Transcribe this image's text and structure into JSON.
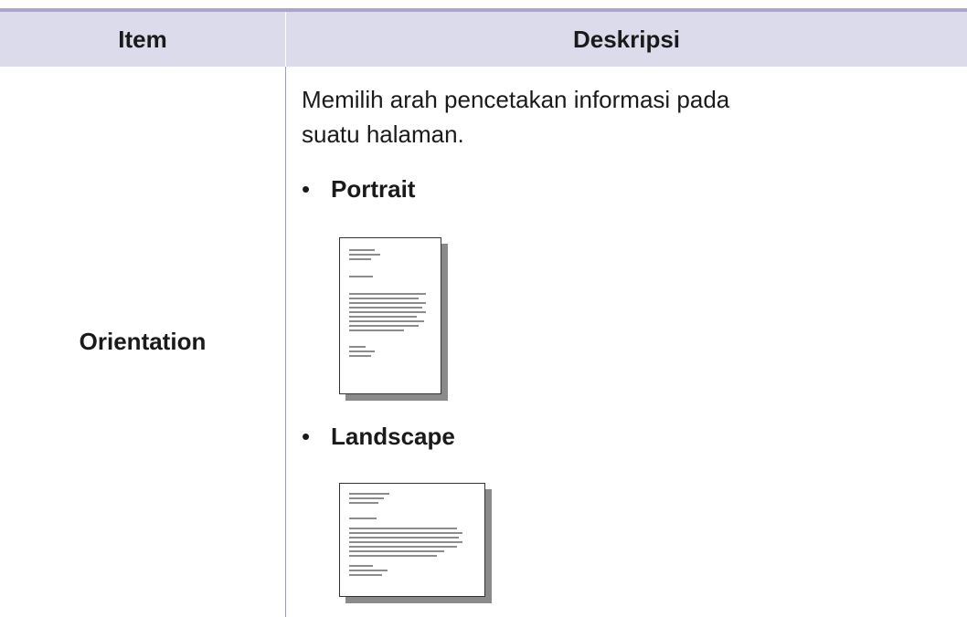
{
  "table": {
    "header": {
      "item": "Item",
      "description": "Deskripsi"
    },
    "row": {
      "item": "Orientation",
      "description": "Memilih arah pencetakan informasi pada suatu halaman.",
      "options": [
        {
          "label": "Portrait",
          "icon": "portrait-page-icon"
        },
        {
          "label": "Landscape",
          "icon": "landscape-page-icon"
        }
      ]
    }
  },
  "colors": {
    "header_bg": "#dcdbeb",
    "top_rule": "#a9a6c8",
    "divider": "#9d9aba",
    "text": "#1a1a1a",
    "page_shadow": "#8a8a8a"
  }
}
